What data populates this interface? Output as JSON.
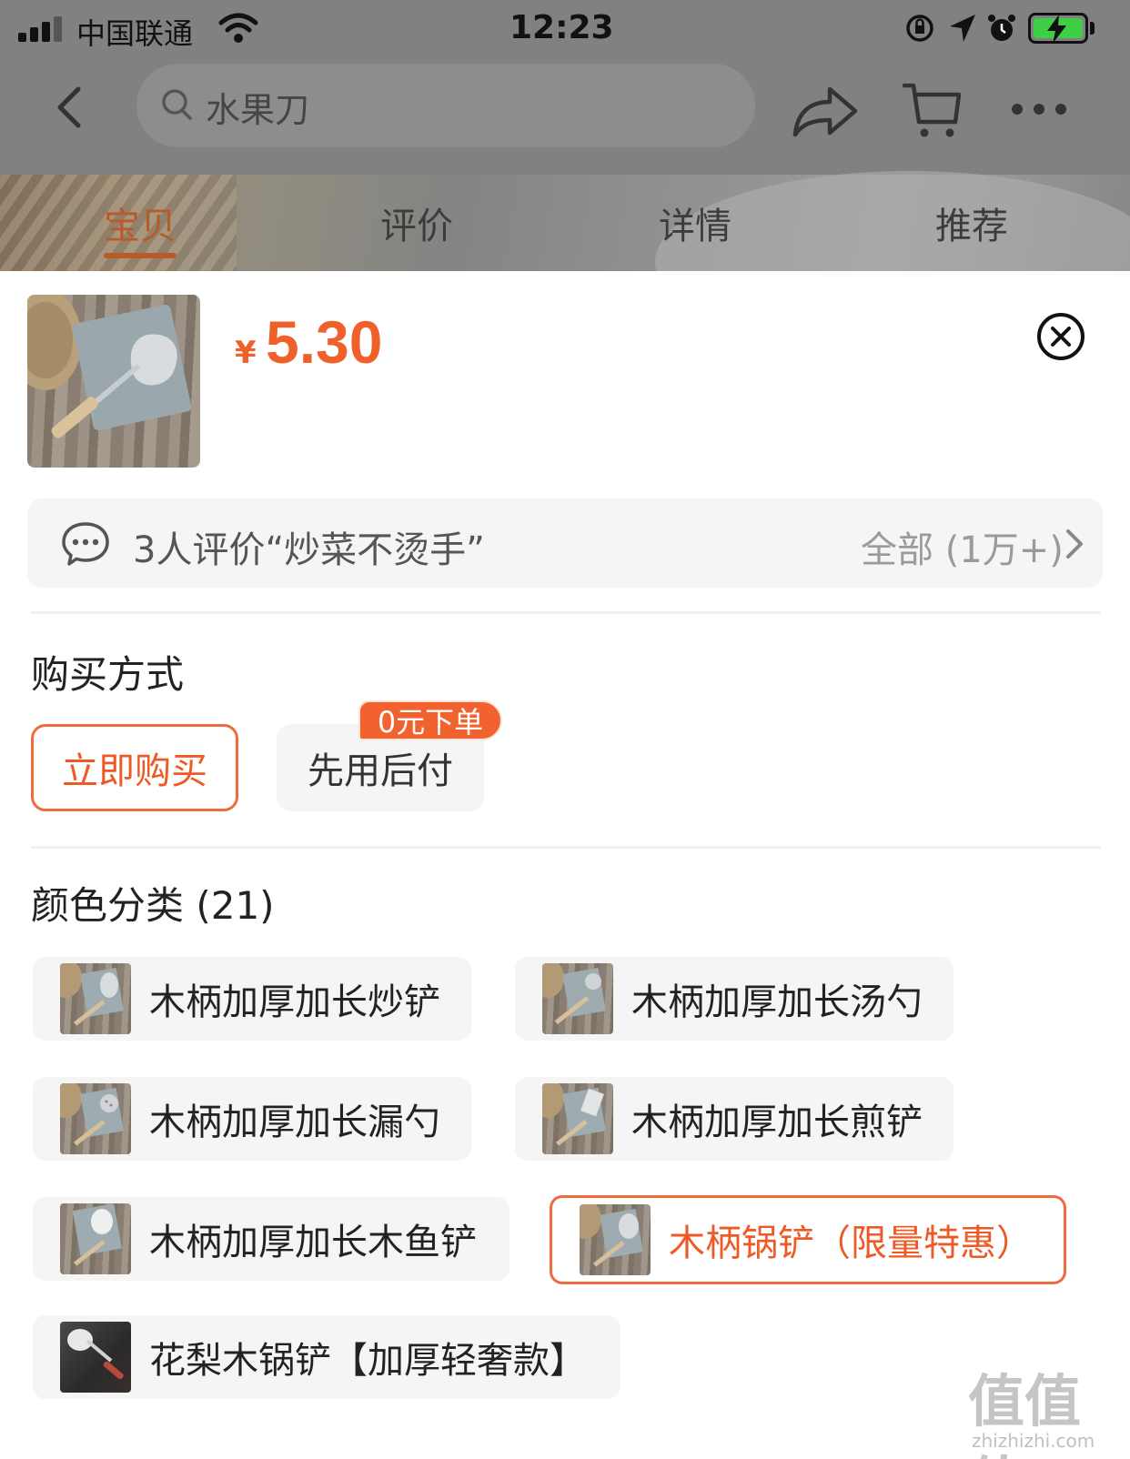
{
  "status_bar": {
    "carrier": "中国联通",
    "time": "12:23"
  },
  "nav": {
    "search_text": "水果刀"
  },
  "tabs": [
    {
      "label": "宝贝",
      "active": true
    },
    {
      "label": "评价",
      "active": false
    },
    {
      "label": "详情",
      "active": false
    },
    {
      "label": "推荐",
      "active": false
    }
  ],
  "product": {
    "currency": "¥",
    "price": "5.30"
  },
  "review": {
    "text": "3人评价“炒菜不烫手”",
    "all_label": "全部 (1万+)"
  },
  "purchase": {
    "title": "购买方式",
    "options": [
      {
        "label": "立即购买",
        "selected": true
      },
      {
        "label": "先用后付",
        "selected": false
      }
    ],
    "badge": "0元下单"
  },
  "color": {
    "title": "颜色分类 (21)",
    "items": [
      {
        "label": "木柄加厚加长炒铲",
        "selected": false
      },
      {
        "label": "木柄加厚加长汤勺",
        "selected": false
      },
      {
        "label": "木柄加厚加长漏勺",
        "selected": false
      },
      {
        "label": "木柄加厚加长煎铲",
        "selected": false
      },
      {
        "label": "木柄加厚加长木鱼铲",
        "selected": false
      },
      {
        "label": "木柄锅铲（限量特惠）",
        "selected": true
      },
      {
        "label": "花梨木锅铲【加厚轻奢款】",
        "selected": false
      }
    ]
  },
  "watermark": {
    "chars": "值值值",
    "url": "zhizhizhi.com"
  },
  "colors": {
    "accent": "#f0602a",
    "selected_border": "#ee6a3f",
    "option_bg": "#f5f5f5"
  }
}
